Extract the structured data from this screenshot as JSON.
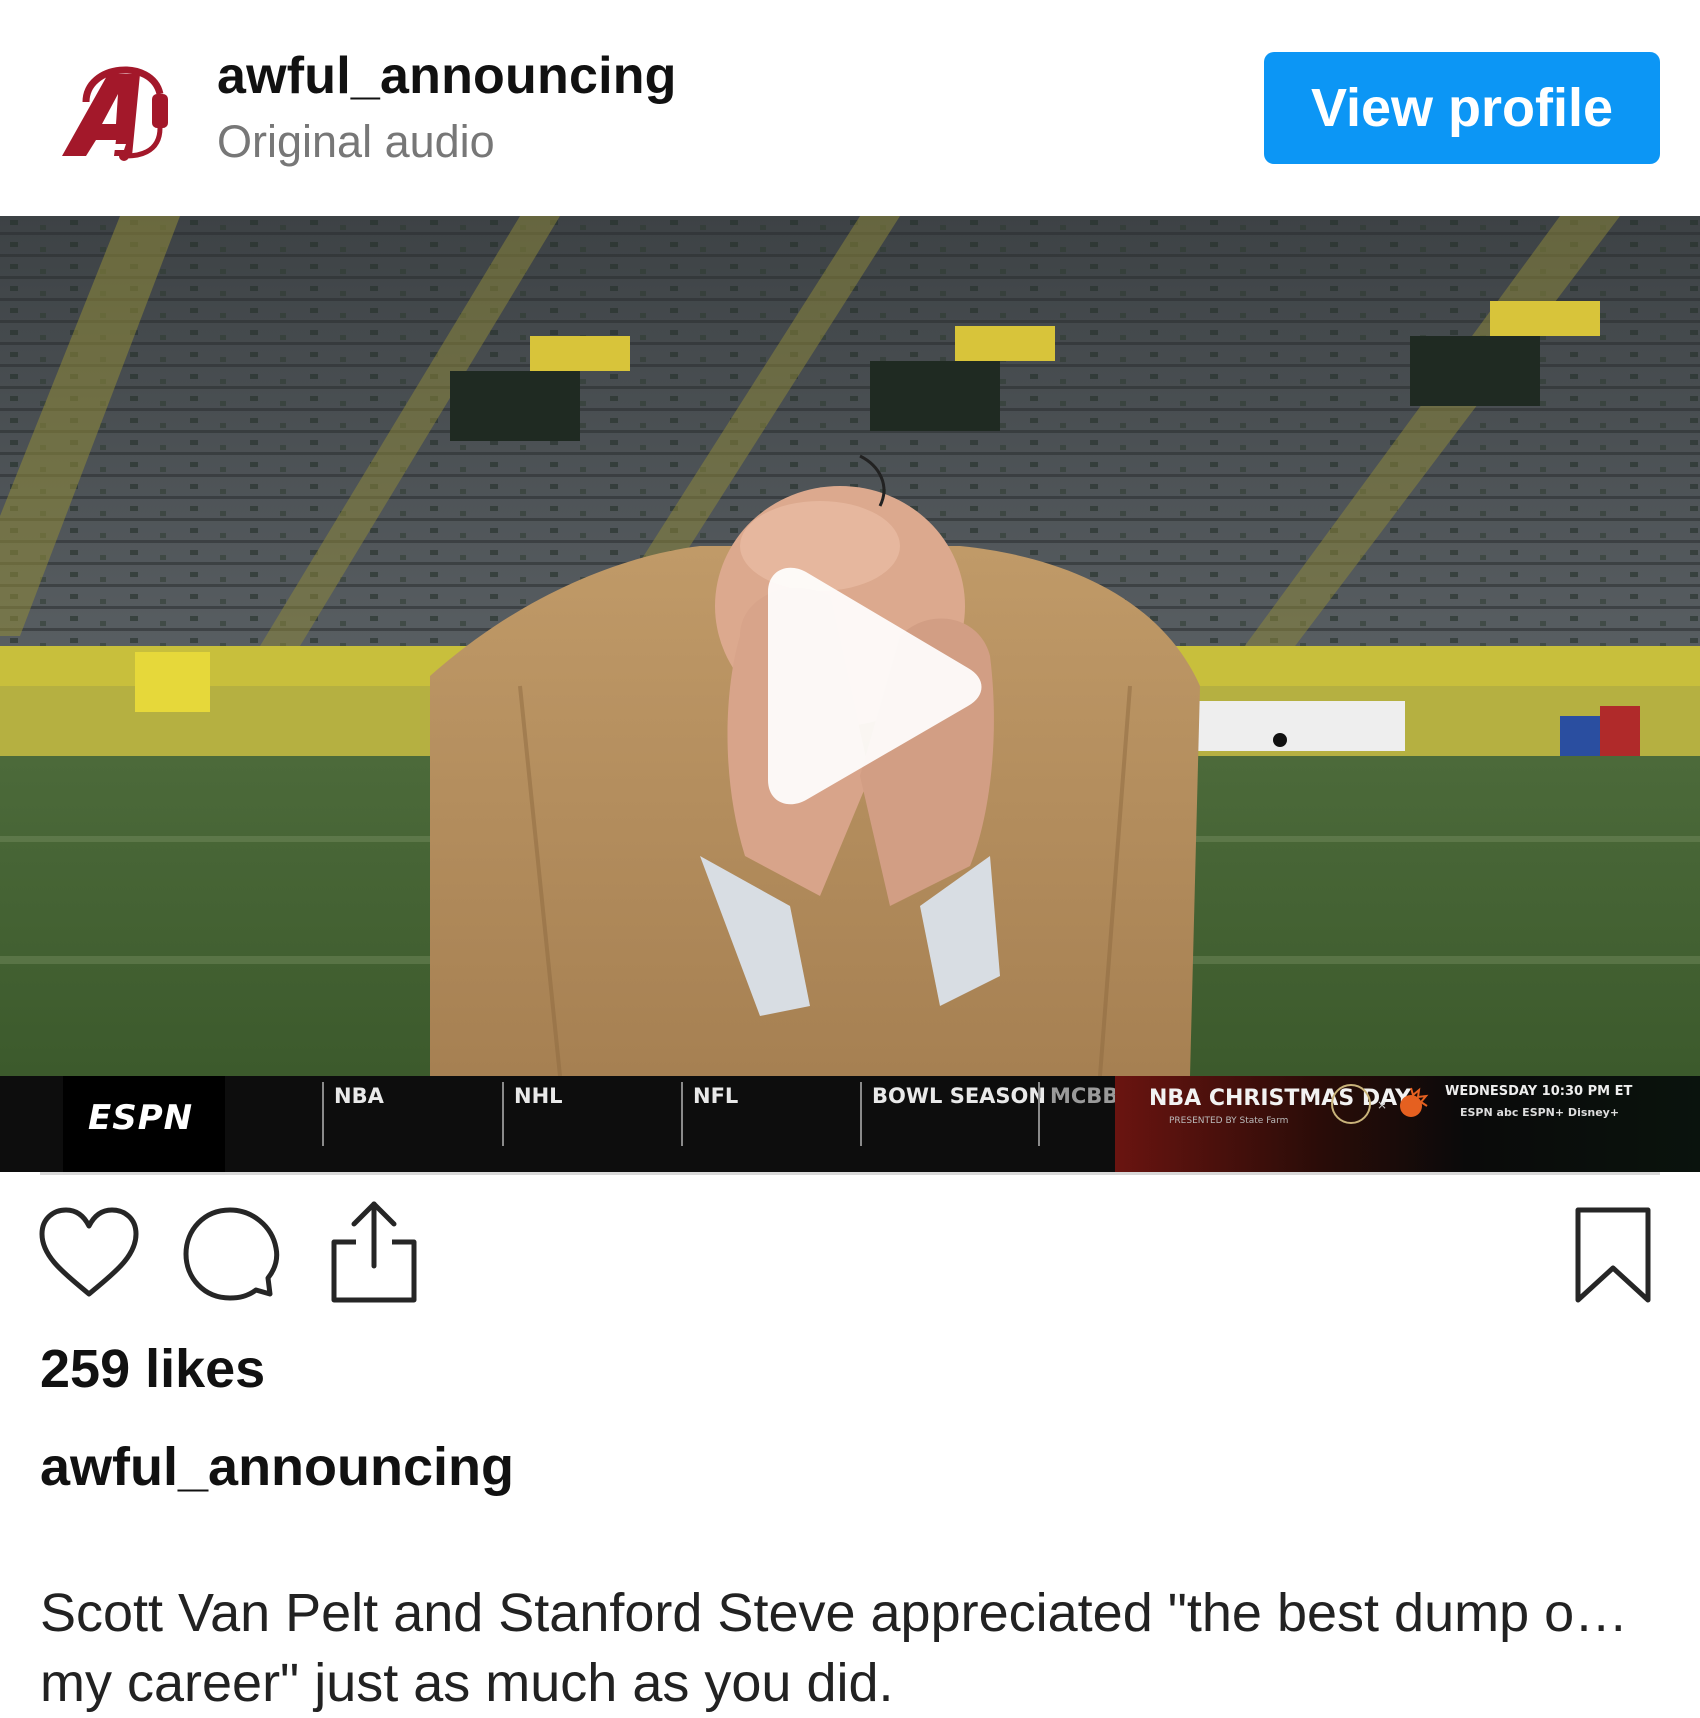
{
  "header": {
    "account_name": "awful_announcing",
    "subtitle": "Original audio",
    "view_profile_label": "View profile",
    "avatar_letter": "A"
  },
  "video": {
    "ticker": {
      "network": "ESPN",
      "tabs": [
        "NBA",
        "NHL",
        "NFL",
        "BOWL SEASON",
        "MCBB"
      ],
      "promo_title": "NBA CHRISTMAS DAY",
      "promo_presented": "PRESENTED BY State Farm",
      "promo_time": "WEDNESDAY 10:30 PM ET",
      "promo_networks": "ESPN  abc  ESPN+  Disney+"
    },
    "play_icon": "play-icon"
  },
  "actions": {
    "like_icon": "heart-icon",
    "comment_icon": "comment-icon",
    "share_icon": "share-icon",
    "save_icon": "bookmark-icon"
  },
  "post": {
    "likes_text": "259 likes",
    "caption_username": "awful_announcing",
    "caption_line1": "Scott Van Pelt and Stanford Steve appreciated \"the best dump o…",
    "caption_line2": "my career\" just as much as you did."
  },
  "colors": {
    "accent": "#0c96f5",
    "brand_red": "#a3182a",
    "text_primary": "#111111",
    "text_secondary": "#777777"
  }
}
